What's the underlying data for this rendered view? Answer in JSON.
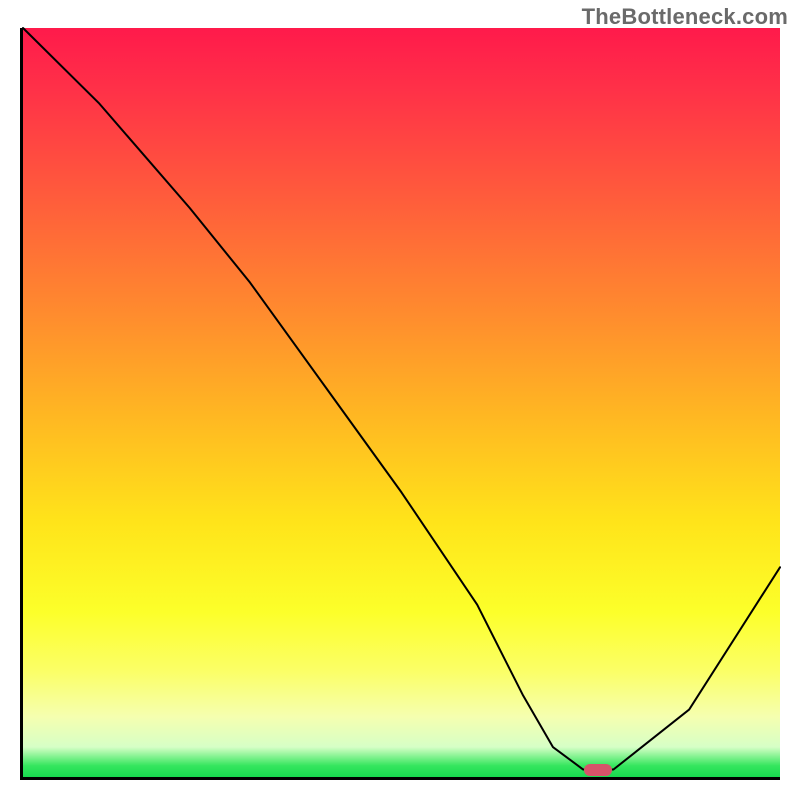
{
  "watermark": "TheBottleneck.com",
  "chart_data": {
    "type": "line",
    "title": "",
    "xlabel": "",
    "ylabel": "",
    "xlim": [
      0,
      100
    ],
    "ylim": [
      0,
      100
    ],
    "grid": false,
    "series": [
      {
        "name": "curve",
        "x": [
          0,
          10,
          22,
          30,
          40,
          50,
          60,
          66,
          70,
          74,
          78,
          88,
          100
        ],
        "values": [
          100,
          90,
          76,
          66,
          52,
          38,
          23,
          11,
          4,
          1,
          1,
          9,
          28
        ]
      }
    ],
    "marker": {
      "x": 76,
      "y": 1
    },
    "gradient_stops": [
      {
        "pct": 0,
        "color": "#ff1a4b"
      },
      {
        "pct": 8,
        "color": "#ff3048"
      },
      {
        "pct": 22,
        "color": "#ff5a3c"
      },
      {
        "pct": 38,
        "color": "#ff8b2e"
      },
      {
        "pct": 52,
        "color": "#ffb822"
      },
      {
        "pct": 66,
        "color": "#ffe41a"
      },
      {
        "pct": 78,
        "color": "#fcff2a"
      },
      {
        "pct": 86,
        "color": "#fbff68"
      },
      {
        "pct": 92,
        "color": "#f5ffb0"
      },
      {
        "pct": 96,
        "color": "#d6ffc6"
      },
      {
        "pct": 98.5,
        "color": "#35e65e"
      },
      {
        "pct": 100,
        "color": "#17d94f"
      }
    ]
  }
}
